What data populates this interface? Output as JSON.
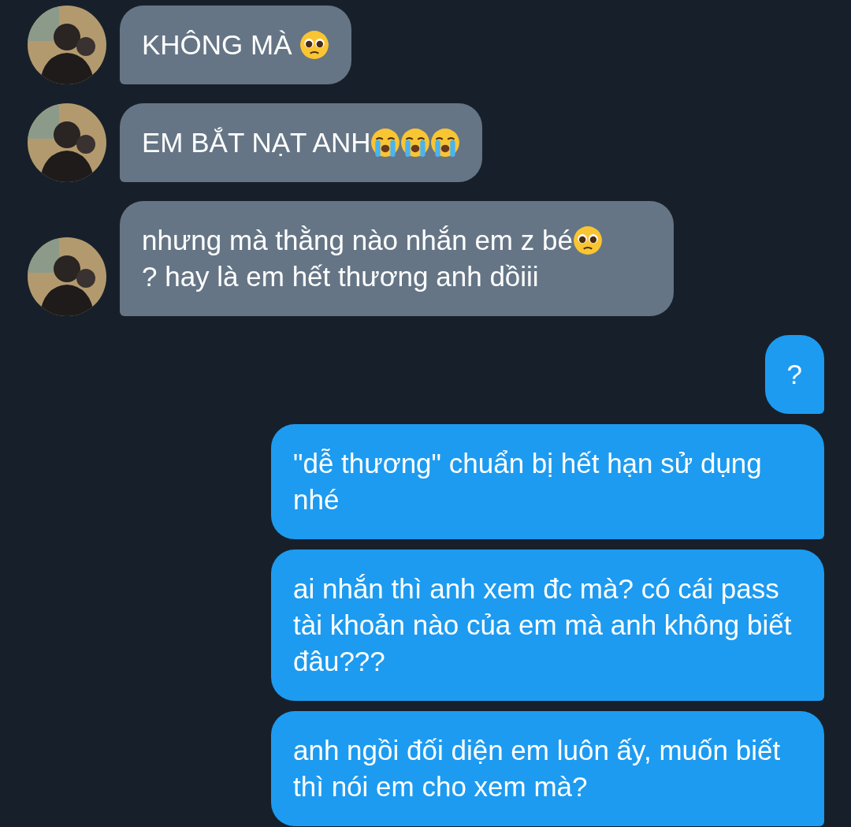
{
  "messages": [
    {
      "kind": "incoming",
      "parts": [
        {
          "kind": "text",
          "text": "KHÔNG MÀ "
        },
        {
          "kind": "pleading"
        }
      ]
    },
    {
      "kind": "incoming",
      "parts": [
        {
          "kind": "text",
          "text": "EM BẮT NẠT ANH"
        },
        {
          "kind": "crying"
        },
        {
          "kind": "crying"
        },
        {
          "kind": "crying"
        }
      ]
    },
    {
      "kind": "incoming",
      "parts": [
        {
          "kind": "text",
          "text": "nhưng mà thằng nào nhắn em z bé"
        },
        {
          "kind": "pleading"
        },
        {
          "kind": "text",
          "text": "? hay là em hết thương anh dồiii"
        }
      ]
    },
    {
      "kind": "outgoing",
      "parts": [
        {
          "kind": "text",
          "text": "?"
        }
      ]
    },
    {
      "kind": "outgoing",
      "parts": [
        {
          "kind": "text",
          "text": "\"dễ thương\" chuẩn bị hết hạn sử dụng nhé"
        }
      ]
    },
    {
      "kind": "outgoing",
      "parts": [
        {
          "kind": "text",
          "text": "ai nhắn thì anh xem đc mà? có cái pass tài khoản nào của em mà anh không biết đâu???"
        }
      ]
    },
    {
      "kind": "outgoing",
      "parts": [
        {
          "kind": "text",
          "text": "anh ngồi đối diện em luôn ấy, muốn biết thì nói em cho xem mà?"
        }
      ]
    }
  ]
}
